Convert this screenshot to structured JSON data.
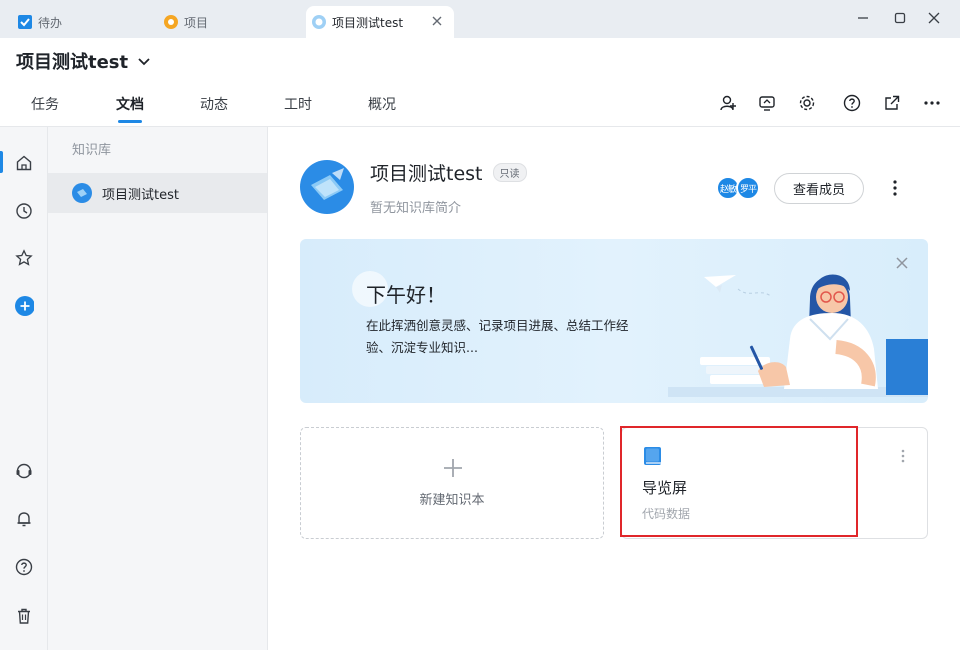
{
  "window_tabs": [
    {
      "label": "待办",
      "icon": "checkbox-icon"
    },
    {
      "label": "项目",
      "icon": "project-icon"
    },
    {
      "label": "项目测试test",
      "icon": "knowledge-base-icon",
      "active": true
    }
  ],
  "header": {
    "project_title": "项目测试test",
    "nav_tabs": [
      "任务",
      "文档",
      "动态",
      "工时",
      "概况"
    ],
    "active_tab": "文档"
  },
  "sidebar": {
    "section_title": "知识库",
    "items": [
      {
        "label": "项目测试test"
      }
    ]
  },
  "kb": {
    "title": "项目测试test",
    "badge": "只读",
    "description": "暂无知识库简介",
    "members": [
      "赵敏",
      "罗平"
    ],
    "members_button": "查看成员"
  },
  "banner": {
    "greeting": "下午好！",
    "text": "在此挥洒创意灵感、记录项目进展、总结工作经验、沉淀专业知识..."
  },
  "cards": {
    "new_label": "新建知识本",
    "book": {
      "name": "导览屏",
      "subtitle": "代码数据"
    }
  },
  "colors": {
    "accent": "#1e88e5",
    "highlight": "#e0262a"
  }
}
